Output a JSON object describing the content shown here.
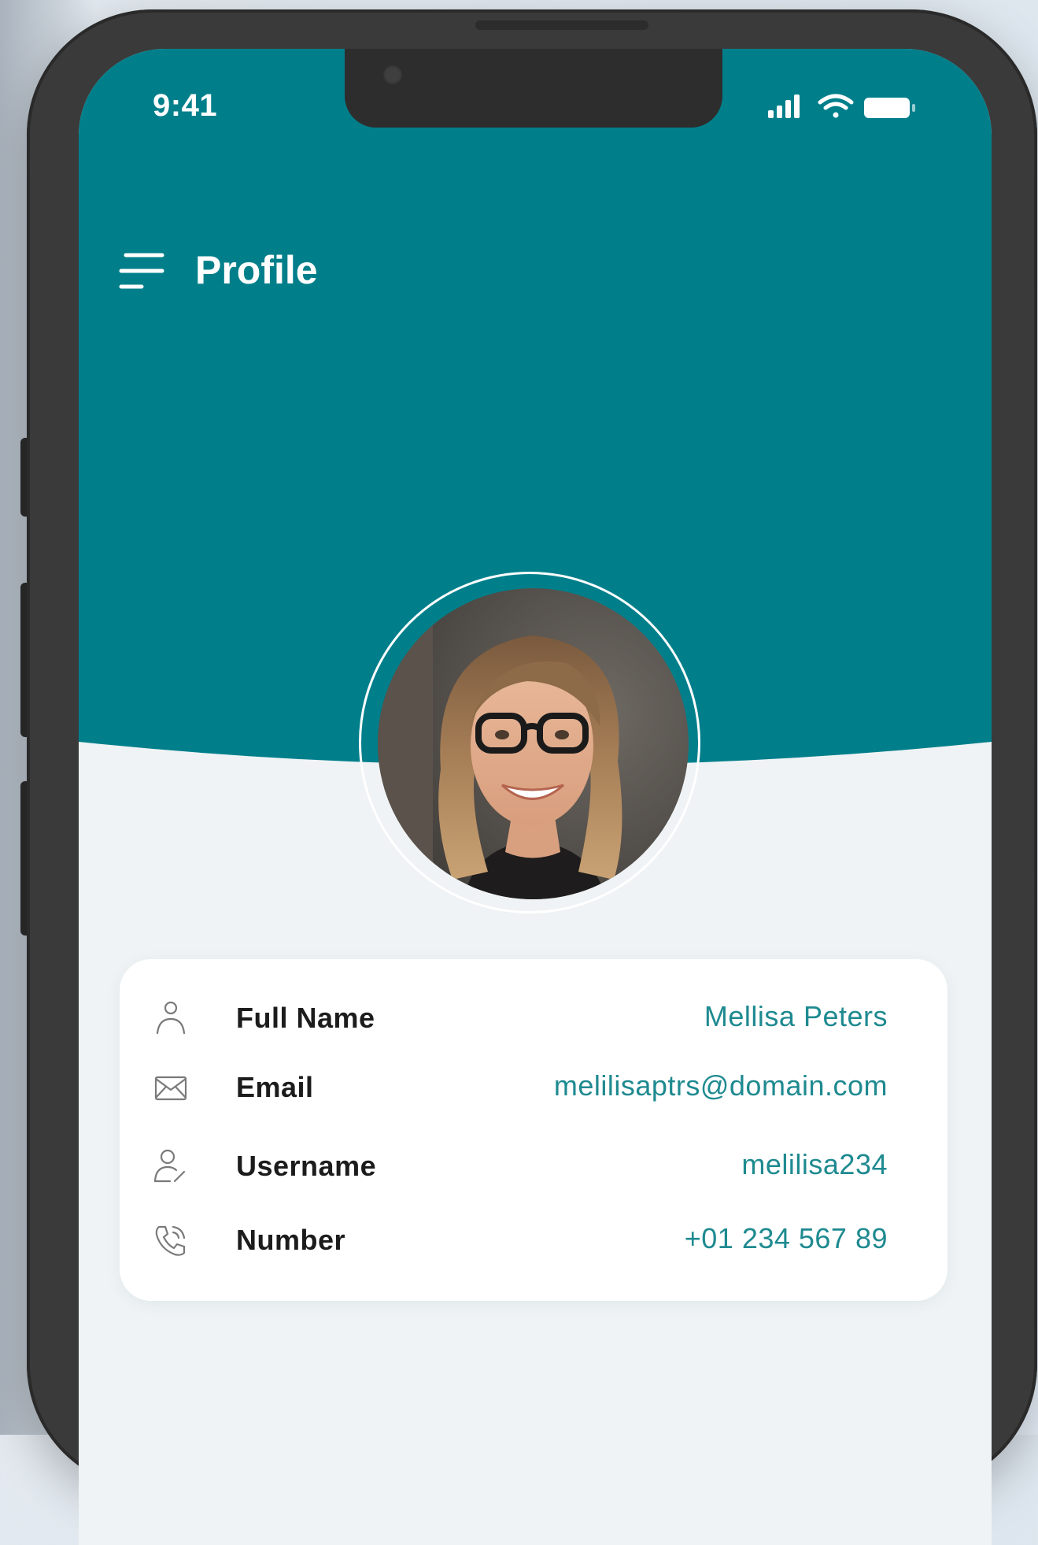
{
  "status_bar": {
    "time": "9:41",
    "icons": [
      "cellular-signal-icon",
      "wifi-icon",
      "battery-icon"
    ]
  },
  "header": {
    "menu_icon": "hamburger-menu-icon",
    "title": "Profile"
  },
  "profile": {
    "avatar": "profile-photo"
  },
  "details": {
    "rows": [
      {
        "icon": "person-icon",
        "label": "Full Name",
        "value": "Mellisa Peters"
      },
      {
        "icon": "mail-icon",
        "label": "Email",
        "value": "melilisaptrs@domain.com"
      },
      {
        "icon": "user-edit-icon",
        "label": "Username",
        "value": "melilisa234"
      },
      {
        "icon": "phone-call-icon",
        "label": "Number",
        "value": "+01 234 567 89"
      }
    ]
  },
  "colors": {
    "primary": "#007f8b",
    "value_text": "#1e8a90",
    "background": "#eff3f5",
    "card": "#ffffff",
    "frame": "#3a3a3a"
  }
}
